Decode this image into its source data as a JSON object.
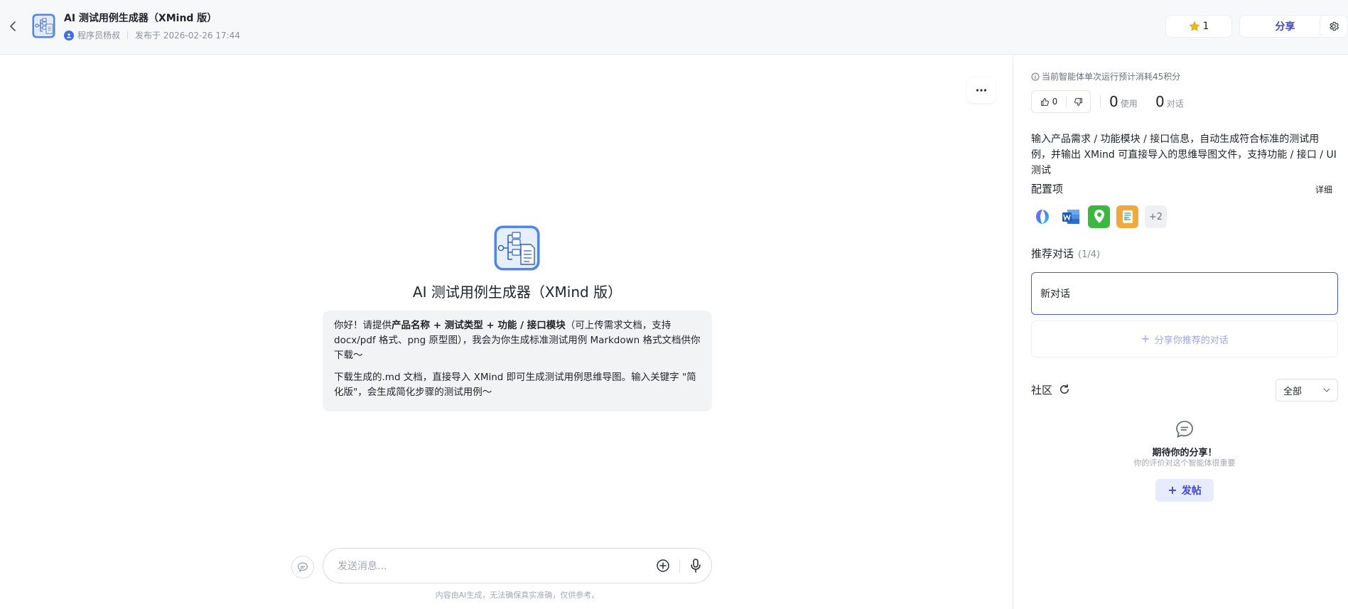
{
  "header": {
    "title": "AI 测试用例生成器（XMind 版）",
    "author": "程序员杨叔",
    "published": "发布于 2026-02-26 17:44",
    "star_count": "1",
    "share_label": "分享"
  },
  "main": {
    "agent_name": "AI 测试用例生成器（XMind 版）",
    "welcome": {
      "p1_prefix": "你好！请提供",
      "p1_bold": "产品名称 + 测试类型 + 功能 / 接口模块",
      "p1_suffix": "（可上传需求文档，支持 docx/pdf 格式、png 原型图），我会为你生成标准测试用例 Markdown 格式文档供你下载～",
      "p2": "下载生成的.md 文档，直接导入 XMind 即可生成测试用例思维导图。输入关键字 \"简化版\"，会生成简化步骤的测试用例～"
    },
    "input_placeholder": "发送消息...",
    "disclaimer": "内容由AI生成，无法确保真实准确，仅供参考。"
  },
  "panel": {
    "cost_text": "当前智能体单次运行预计消耗45积分",
    "likes": "0",
    "uses": "0",
    "uses_label": "使用",
    "conversations": "0",
    "conversations_label": "对话",
    "description": "输入产品需求 / 功能模块 / 接口信息，自动生成符合标准的测试用例，并输出 XMind 可直接导入的思维导图文件，支持功能 / 接口 / UI 测试",
    "config_title": "配置项",
    "detail_label": "详细",
    "config_more": "+2",
    "recommend_title": "推荐对话",
    "recommend_count": "(1/4)",
    "recommend_item": "新对话",
    "share_conv_label": "分享你推荐的对话",
    "community_title": "社区",
    "filter_value": "全部",
    "empty_title": "期待你的分享！",
    "empty_sub": "你的评价对这个智能体很重要",
    "post_label": "发帖"
  }
}
